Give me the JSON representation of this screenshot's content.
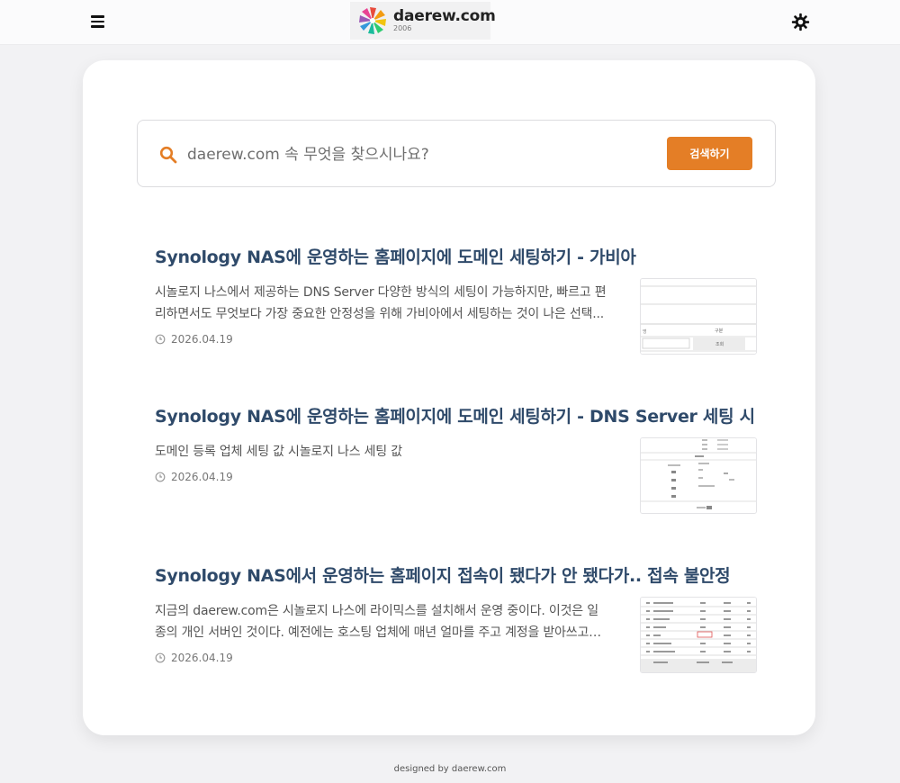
{
  "header": {
    "logo_name": "daerew.com",
    "logo_year": "2006",
    "menu_icon": "hamburger-menu-icon",
    "theme_icon": "sun-icon"
  },
  "search": {
    "placeholder": "daerew.com 속 무엇을 찾으시나요?",
    "value": "",
    "button_label": "검색하기",
    "icon": "search-icon"
  },
  "posts": [
    {
      "title": "Synology NAS에 운영하는 홈페이지에 도메인 세팅하기 - 가비아",
      "excerpt": "시놀로지 나스에서 제공하는 DNS Server 다양한 방식의 세팅이 가능하지만, 빠르고 편리하면서도 무엇보다 가장 중요한 안정성을 위해 가비아에서 세팅하는 것이 나은 선택...",
      "date": "2026.04.19",
      "thumb_cell_1": "구분",
      "thumb_cell_2": "조회"
    },
    {
      "title": "Synology NAS에 운영하는 홈페이지에 도메인 세팅하기 - DNS Server 세팅 시",
      "excerpt": "도메인 등록 업체 세팅 값 시놀로지 나스 세팅 값",
      "date": "2026.04.19"
    },
    {
      "title": "Synology NAS에서 운영하는 홈페이지 접속이 됐다가 안 됐다가.. 접속 불안정",
      "excerpt": "지금의 daerew.com은 시놀로지 나스에 라이믹스를 설치해서 운영 중이다. 이것은 일종의 개인 서버인 것이다. 예전에는 호스팅 업체에 매년 얼마를 주고 계정을 받아쓰고 도...",
      "date": "2026.04.19"
    }
  ],
  "footer": {
    "text": "designed by daerew.com"
  },
  "colors": {
    "accent": "#e47e26",
    "title": "#2f4a6a",
    "background": "#f2f2f4"
  }
}
